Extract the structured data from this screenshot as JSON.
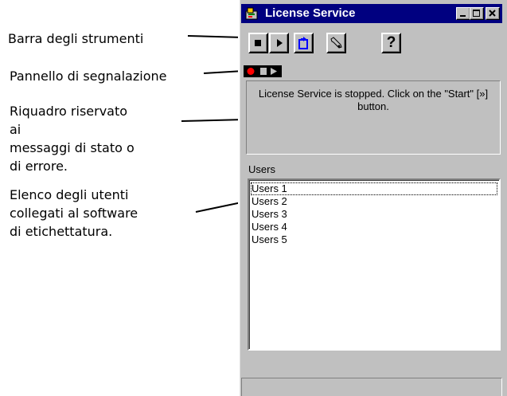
{
  "annotations": {
    "toolbar": "Barra degli strumenti",
    "signal_panel": "Pannello di segnalazione",
    "message_area": [
      "Riquadro riservato",
      "ai",
      "messaggi di stato o",
      "di errore."
    ],
    "users_list": [
      "Elenco degli utenti",
      "collegati al software",
      "di etichettatura."
    ]
  },
  "window": {
    "title": "License Service",
    "title_icon": "license-service-icon",
    "controls": [
      "minimize-icon",
      "maximize-icon",
      "close-icon"
    ]
  },
  "toolbar": {
    "buttons": [
      {
        "name": "stop",
        "icon": "stop-icon"
      },
      {
        "name": "start",
        "icon": "play-icon"
      },
      {
        "name": "refresh",
        "icon": "refresh-icon"
      },
      {
        "name": "settings",
        "icon": "wrench-icon"
      },
      {
        "name": "help",
        "icon": "help-icon",
        "label": "?"
      }
    ]
  },
  "signal": {
    "lights": [
      "record-light",
      "stop-light",
      "play-light"
    ],
    "record_color": "#ff0000"
  },
  "message": {
    "text": "License Service is stopped. Click on the \"Start\" [»] button."
  },
  "users": {
    "label": "Users",
    "items": [
      "Users 1",
      "Users 2",
      "Users 3",
      "Users 4",
      "Users 5"
    ],
    "focused_index": 0
  },
  "colors": {
    "titlebar": "#000080",
    "face": "#c0c0c0"
  }
}
